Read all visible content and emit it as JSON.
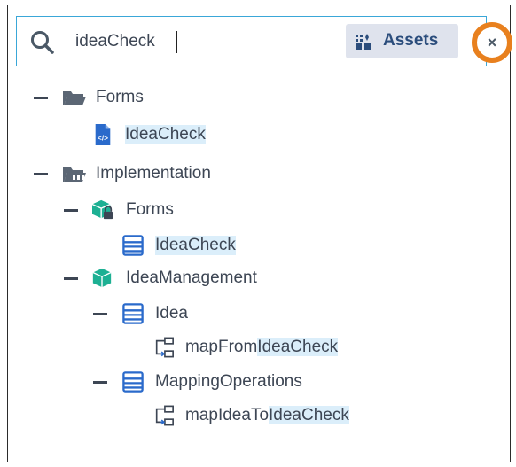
{
  "search": {
    "value": "ideaCheck",
    "assets_label": "Assets",
    "close_label": "×"
  },
  "tree": [
    {
      "key": "forms_root",
      "label": "Forms",
      "icon": "folder-open-icon",
      "expanded": true
    },
    {
      "key": "ideacheck_form",
      "label": "IdeaCheck",
      "icon": "html-file-icon",
      "highlight_full": true
    },
    {
      "key": "implementation",
      "label": "Implementation",
      "icon": "implementation-folder-icon",
      "expanded": true
    },
    {
      "key": "impl_forms",
      "label": "Forms",
      "icon": "locked-package-icon",
      "expanded": true
    },
    {
      "key": "impl_ideacheck",
      "label": "IdeaCheck",
      "icon": "document-type-icon",
      "highlight_full": true
    },
    {
      "key": "idea_management",
      "label": "IdeaManagement",
      "icon": "package-icon",
      "expanded": true
    },
    {
      "key": "idea",
      "label": "Idea",
      "icon": "document-type-icon",
      "expanded": true
    },
    {
      "key": "map_from",
      "label_prefix": "mapFrom",
      "label_match": "IdeaCheck",
      "icon": "mapping-icon"
    },
    {
      "key": "mapping_operations",
      "label": "MappingOperations",
      "icon": "document-type-icon",
      "expanded": true
    },
    {
      "key": "map_idea_to",
      "label_prefix": "mapIdeaTo",
      "label_match": "IdeaCheck",
      "icon": "mapping-icon"
    }
  ],
  "colors": {
    "focus_border": "#3aa7d8",
    "close_ring": "#e8801e",
    "highlight": "#dbeefa",
    "icon_blue": "#2a6acb",
    "icon_teal": "#1db093"
  }
}
